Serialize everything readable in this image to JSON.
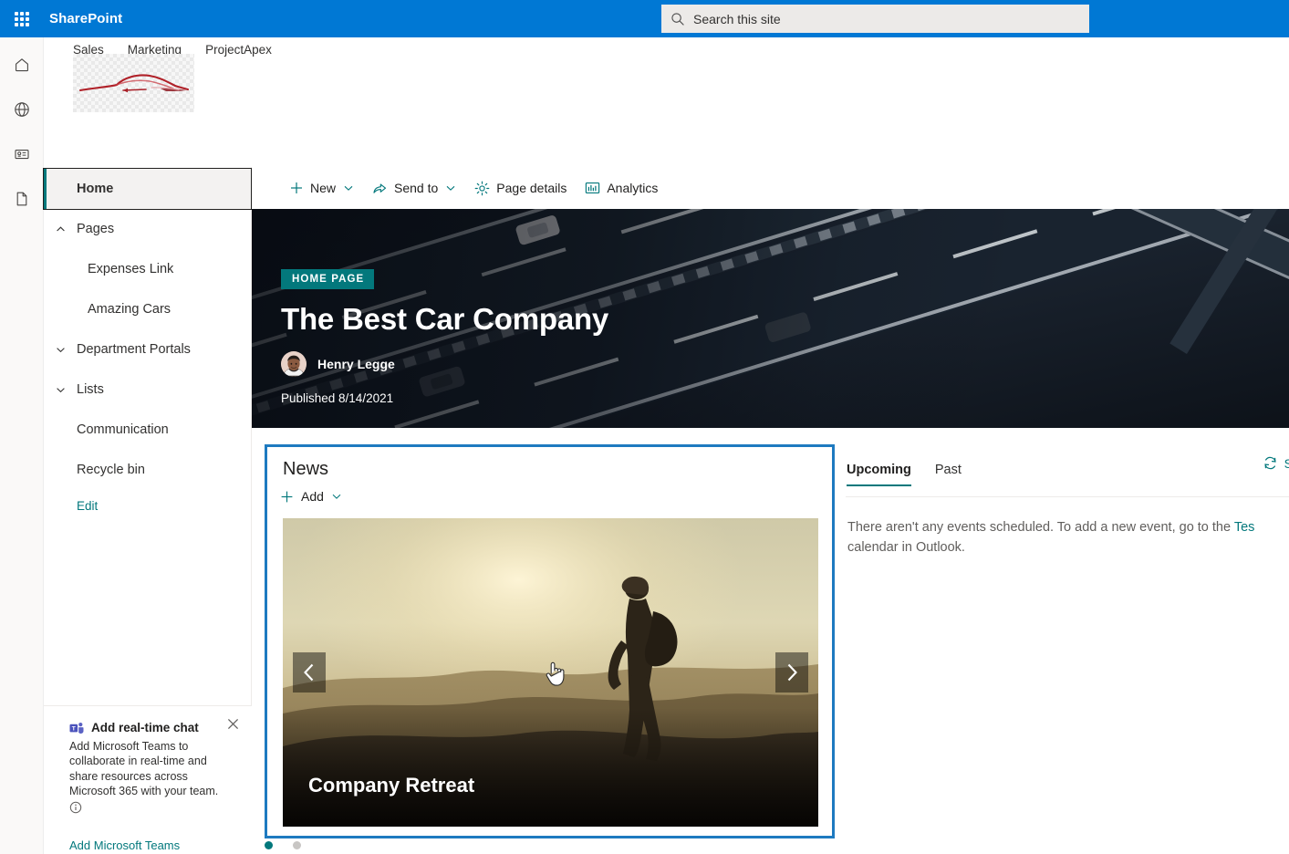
{
  "suite": {
    "waffle_label": "app-launcher",
    "title": "SharePoint",
    "search_placeholder": "Search this site",
    "search_value": "",
    "brand_color": "#0078d4"
  },
  "rail": {
    "items": [
      {
        "name": "home",
        "icon": "home-icon"
      },
      {
        "name": "globe",
        "icon": "globe-icon"
      },
      {
        "name": "news",
        "icon": "news-icon"
      },
      {
        "name": "page",
        "icon": "page-icon"
      }
    ]
  },
  "site_header": {
    "nav_links": [
      "Sales",
      "Marketing",
      "ProjectApex"
    ],
    "logo_alt": "Car company logo"
  },
  "leftnav": {
    "items": [
      {
        "label": "Home",
        "selected": true,
        "level": 0,
        "chevron": ""
      },
      {
        "label": "Pages",
        "selected": false,
        "level": 0,
        "chevron": "up"
      },
      {
        "label": "Expenses Link",
        "selected": false,
        "level": 1,
        "chevron": ""
      },
      {
        "label": "Amazing Cars",
        "selected": false,
        "level": 1,
        "chevron": ""
      },
      {
        "label": "Department Portals",
        "selected": false,
        "level": 0,
        "chevron": "down"
      },
      {
        "label": "Lists",
        "selected": false,
        "level": 0,
        "chevron": "down"
      },
      {
        "label": "Communication",
        "selected": false,
        "level": 0,
        "chevron": ""
      },
      {
        "label": "Recycle bin",
        "selected": false,
        "level": 0,
        "chevron": ""
      }
    ],
    "edit_label": "Edit",
    "accent_color": "#03787c"
  },
  "teams_promo": {
    "title": "Add real-time chat",
    "description": "Add Microsoft Teams to collaborate in real-time and share resources across Microsoft 365 with your team.",
    "link_label": "Add Microsoft Teams",
    "close_label": "Close"
  },
  "commandbar": {
    "items": [
      {
        "label": "New",
        "icon": "plus-icon",
        "chevron": true
      },
      {
        "label": "Send to",
        "icon": "share-icon",
        "chevron": true
      },
      {
        "label": "Page details",
        "icon": "gear-icon",
        "chevron": false
      },
      {
        "label": "Analytics",
        "icon": "analytics-icon",
        "chevron": false
      }
    ]
  },
  "hero": {
    "badge": "HOME PAGE",
    "title": "The Best Car Company",
    "author": "Henry Legge",
    "published": "Published 8/14/2021",
    "badge_color": "#03787c",
    "image_alt": "Aerial view of a highway interchange at night"
  },
  "news": {
    "title": "News",
    "add_label": "Add",
    "card_title": "Company Retreat",
    "card_image_alt": "Hiker at sunrise on a mountain ridge",
    "prev_label": "Previous",
    "next_label": "Next",
    "dots": [
      {
        "active": true,
        "color": "#03787c"
      },
      {
        "active": false,
        "color": "#c8c6c4"
      }
    ],
    "selection_color": "#1e7ac0"
  },
  "events": {
    "tabs": [
      {
        "label": "Upcoming",
        "active": true
      },
      {
        "label": "Past",
        "active": false
      }
    ],
    "see_all_label": "S",
    "empty_text_before": "There aren't any events scheduled. To add a new event, go to the ",
    "empty_link": "Tes",
    "empty_text_after": "calendar in Outlook."
  }
}
